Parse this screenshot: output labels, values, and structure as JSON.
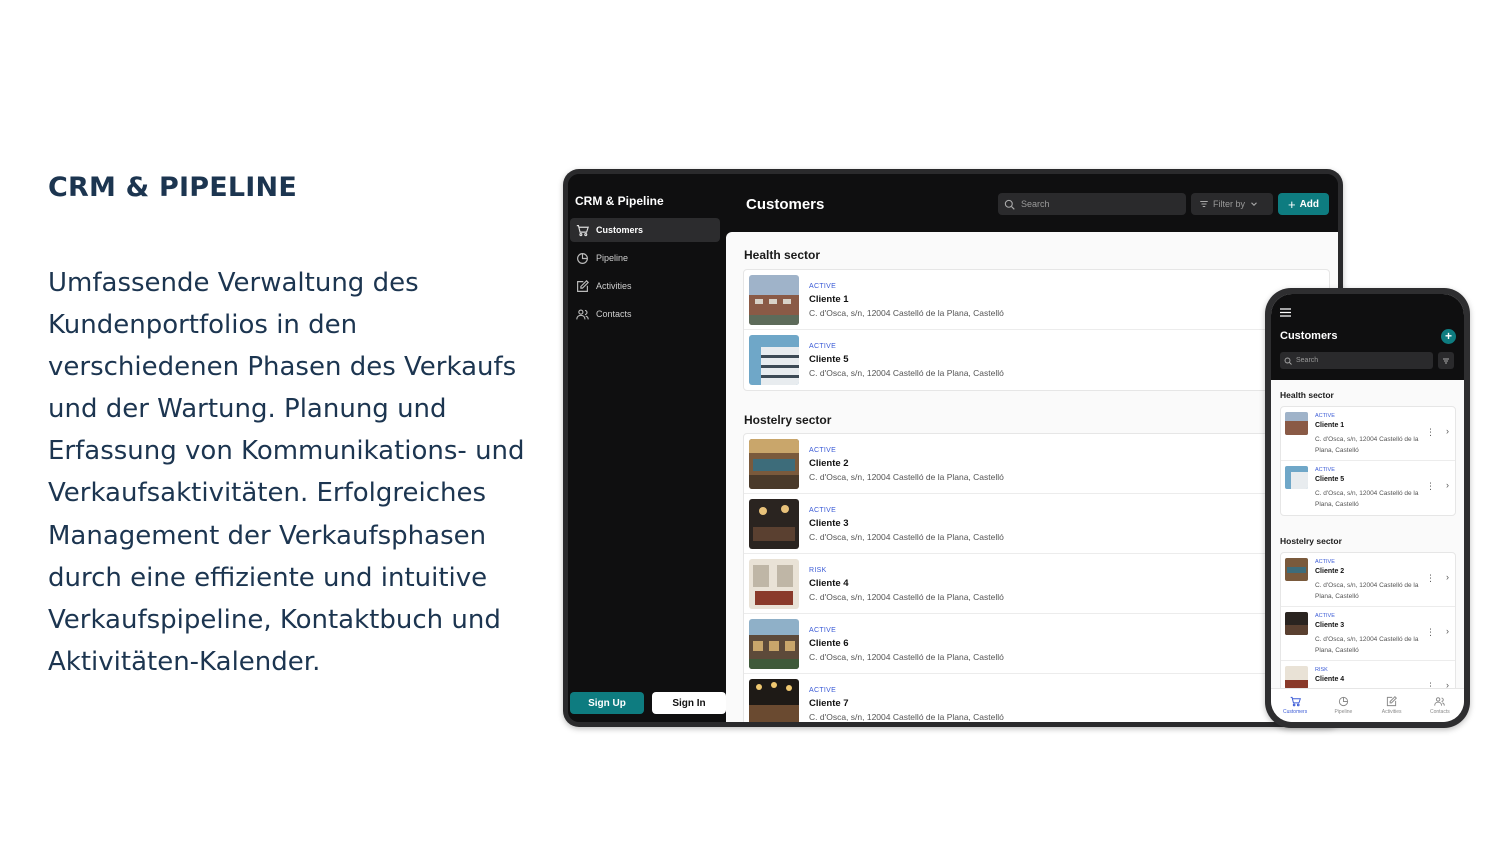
{
  "slide": {
    "title": "CRM & PIPELINE",
    "description": "Umfassende Verwaltung des Kundenportfolios in den verschiedenen Phasen des Verkaufs und der Wartung. Planung und Erfassung von Kommunikations- und Verkaufsaktivitäten. Erfolgreiches Management der Verkaufsphasen durch eine effiziente und intuitive Verkaufspipeline, Kontaktbuch und Aktivitäten-Kalender."
  },
  "colors": {
    "accent": "#0e7c80",
    "status": "#3b5bd6",
    "dark": "#0f0f10",
    "title": "#1c3550"
  },
  "tablet": {
    "app_title": "CRM & Pipeline",
    "nav": [
      {
        "label": "Customers",
        "icon": "cart-icon"
      },
      {
        "label": "Pipeline",
        "icon": "pie-chart-icon"
      },
      {
        "label": "Activities",
        "icon": "edit-icon"
      },
      {
        "label": "Contacts",
        "icon": "users-icon"
      }
    ],
    "signup_label": "Sign Up",
    "signin_label": "Sign In",
    "page_title": "Customers",
    "search_placeholder": "Search",
    "filter_label": "Filter by",
    "add_label": "Add",
    "sections": [
      {
        "title": "Health sector",
        "rows": [
          {
            "status": "ACTIVE",
            "name": "Cliente 1",
            "address": "C. d'Osca, s/n, 12004 Castelló de la Plana, Castelló"
          },
          {
            "status": "ACTIVE",
            "name": "Cliente 5",
            "address": "C. d'Osca, s/n, 12004 Castelló de la Plana, Castelló"
          }
        ]
      },
      {
        "title": "Hostelry sector",
        "rows": [
          {
            "status": "ACTIVE",
            "name": "Cliente 2",
            "address": "C. d'Osca, s/n, 12004 Castelló de la Plana, Castelló"
          },
          {
            "status": "ACTIVE",
            "name": "Cliente 3",
            "address": "C. d'Osca, s/n, 12004 Castelló de la Plana, Castelló"
          },
          {
            "status": "RISK",
            "name": "Cliente 4",
            "address": "C. d'Osca, s/n, 12004 Castelló de la Plana, Castelló"
          },
          {
            "status": "ACTIVE",
            "name": "Cliente 6",
            "address": "C. d'Osca, s/n, 12004 Castelló de la Plana, Castelló"
          },
          {
            "status": "ACTIVE",
            "name": "Cliente 7",
            "address": "C. d'Osca, s/n, 12004 Castelló de la Plana, Castelló"
          }
        ]
      }
    ]
  },
  "phone": {
    "page_title": "Customers",
    "search_placeholder": "Search",
    "sections": [
      {
        "title": "Health sector",
        "rows": [
          {
            "status": "ACTIVE",
            "name": "Cliente 1",
            "address": "C. d'Osca, s/n, 12004 Castelló de la Plana, Castelló"
          },
          {
            "status": "ACTIVE",
            "name": "Cliente 5",
            "address": "C. d'Osca, s/n, 12004 Castelló de la Plana, Castelló"
          }
        ]
      },
      {
        "title": "Hostelry sector",
        "rows": [
          {
            "status": "ACTIVE",
            "name": "Cliente 2",
            "address": "C. d'Osca, s/n, 12004 Castelló de la Plana, Castelló"
          },
          {
            "status": "ACTIVE",
            "name": "Cliente 3",
            "address": "C. d'Osca, s/n, 12004 Castelló de la Plana, Castelló"
          },
          {
            "status": "RISK",
            "name": "Cliente 4",
            "address": ""
          }
        ]
      }
    ],
    "tabs": [
      "Customers",
      "Pipeline",
      "Activities",
      "Contacts"
    ]
  }
}
